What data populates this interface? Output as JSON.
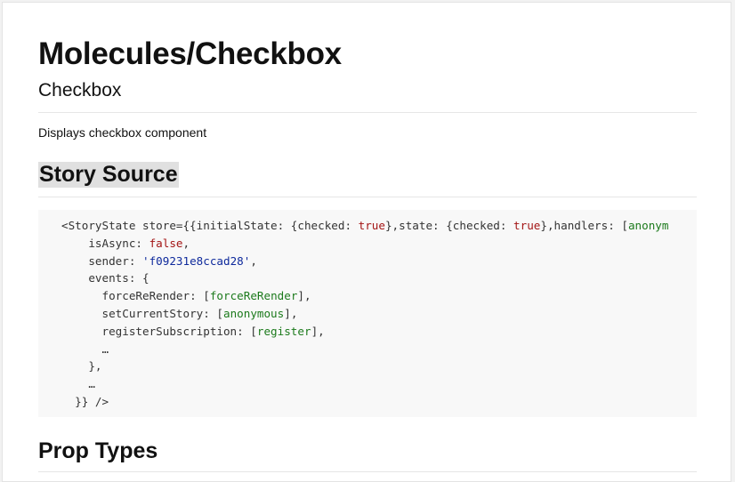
{
  "page": {
    "title": "Molecules/Checkbox",
    "subtitle": "Checkbox",
    "description": "Displays checkbox component"
  },
  "sections": {
    "story_source": "Story Source",
    "prop_types": "Prop Types"
  },
  "code": {
    "line1_a": "<StoryState store={{initialState: {checked: ",
    "line1_true1": "true",
    "line1_b": "},state: {checked: ",
    "line1_true2": "true",
    "line1_c": "},handlers: [",
    "line1_anon": "anonym",
    "line2_a": "isAsync: ",
    "line2_false": "false",
    "line2_b": ",",
    "line3_a": "sender: ",
    "line3_str": "'f09231e8ccad28'",
    "line3_b": ",",
    "line4": "events: {",
    "line5_a": "forceReRender: [",
    "line5_fn": "forceReRender",
    "line5_b": "],",
    "line6_a": "setCurrentStory: [",
    "line6_fn": "anonymous",
    "line6_b": "],",
    "line7_a": "registerSubscription: [",
    "line7_fn": "register",
    "line7_b": "],",
    "line8": "…",
    "line9": "},",
    "line10": "…",
    "line11": "}} />"
  },
  "colors": {
    "boolean": "#a31515",
    "string": "#0f2a9c",
    "function": "#1c7a1c",
    "code_bg": "#f8f8f8"
  }
}
